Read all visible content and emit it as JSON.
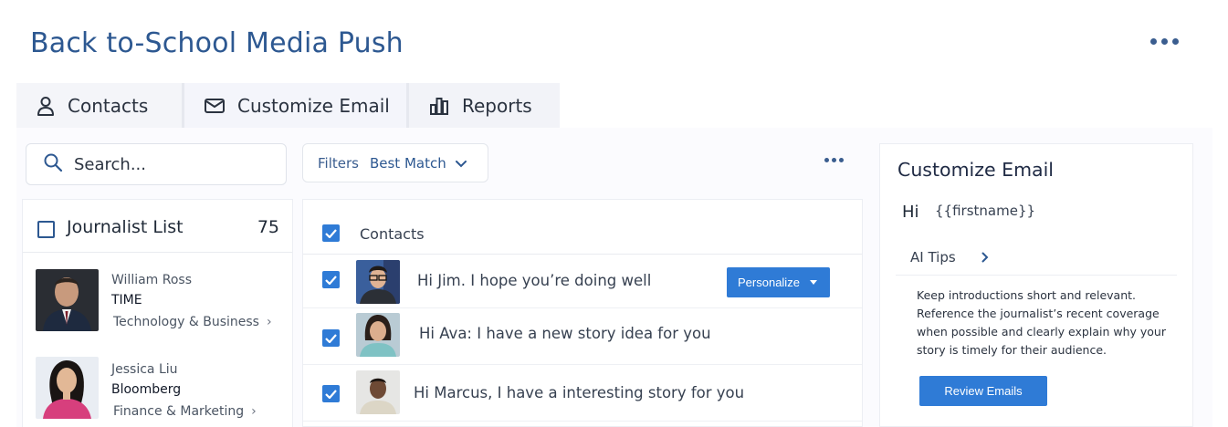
{
  "page": {
    "title": "Back to-School Media Push"
  },
  "tabs": [
    {
      "label": "Contacts",
      "icon": "user-icon"
    },
    {
      "label": "Customize Email",
      "icon": "mail-icon"
    },
    {
      "label": "Reports",
      "icon": "bar-chart-icon"
    }
  ],
  "search": {
    "placeholder": "Search..."
  },
  "filters": {
    "label": "Filters",
    "selected": "Best Match"
  },
  "journalist_list": {
    "title": "Journalist List",
    "count": "75",
    "items": [
      {
        "name": "William Ross",
        "outlet": "TIME",
        "beat": "Technology & Business"
      },
      {
        "name": "Jessica Liu",
        "outlet": "Bloomberg",
        "beat": "Finance & Marketing"
      }
    ]
  },
  "contacts": {
    "header": "Contacts",
    "rows": [
      {
        "subject": "Hi Jim. I hope you’re doing well",
        "checked": true
      },
      {
        "subject": "Hi Ava: I have a new story idea for you",
        "checked": true
      },
      {
        "subject": "Hi Marcus, I have a interesting story for you",
        "checked": true
      }
    ],
    "personalize_label": "Personalize"
  },
  "customize_email": {
    "title": "Customize Email",
    "greeting": "Hi",
    "token": "{{firstname}}",
    "ai_tips_label": "AI Tips",
    "tips": [
      "Keep introductions short and relevant.",
      "Reference the journalist’s recent coverage",
      "when possible and clearly explain why your",
      "story is timely for their audience."
    ],
    "review_label": "Review Emails"
  },
  "colors": {
    "accent": "#2f7bd6",
    "title": "#2d5891"
  }
}
